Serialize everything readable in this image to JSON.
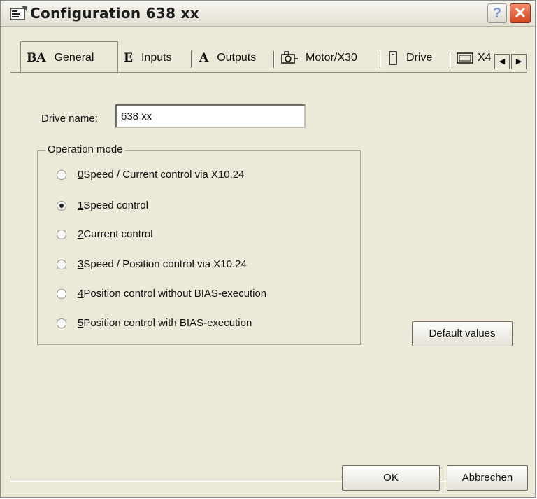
{
  "window": {
    "title": "Configuration 638 xx",
    "help_label": "?",
    "close_label": "✕"
  },
  "tabs": [
    {
      "glyph": "BA",
      "label": "General"
    },
    {
      "glyph": "E",
      "label": "Inputs"
    },
    {
      "glyph": "A",
      "label": "Outputs"
    },
    {
      "glyph": "motor-icon",
      "label": "Motor/X30"
    },
    {
      "glyph": "drive-icon",
      "label": "Drive"
    },
    {
      "glyph": "x4-icon",
      "label": "X4"
    }
  ],
  "tab_scroll": {
    "left": "◀",
    "right": "▶"
  },
  "drive": {
    "label": "Drive name:",
    "value": "638 xx"
  },
  "operation_mode": {
    "label": "Operation mode",
    "options": [
      {
        "key": "0",
        "text": " Speed / Current control via X10.24",
        "checked": false
      },
      {
        "key": "1",
        "text": " Speed control",
        "checked": true
      },
      {
        "key": "2",
        "text": " Current control",
        "checked": false
      },
      {
        "key": "3",
        "text": " Speed / Position control via X10.24",
        "checked": false
      },
      {
        "key": "4",
        "text": " Position control without BIAS-execution",
        "checked": false
      },
      {
        "key": "5",
        "text": " Position control with BIAS-execution",
        "checked": false
      }
    ]
  },
  "buttons": {
    "default_values": "Default values",
    "ok": "OK",
    "cancel": "Abbrechen"
  }
}
